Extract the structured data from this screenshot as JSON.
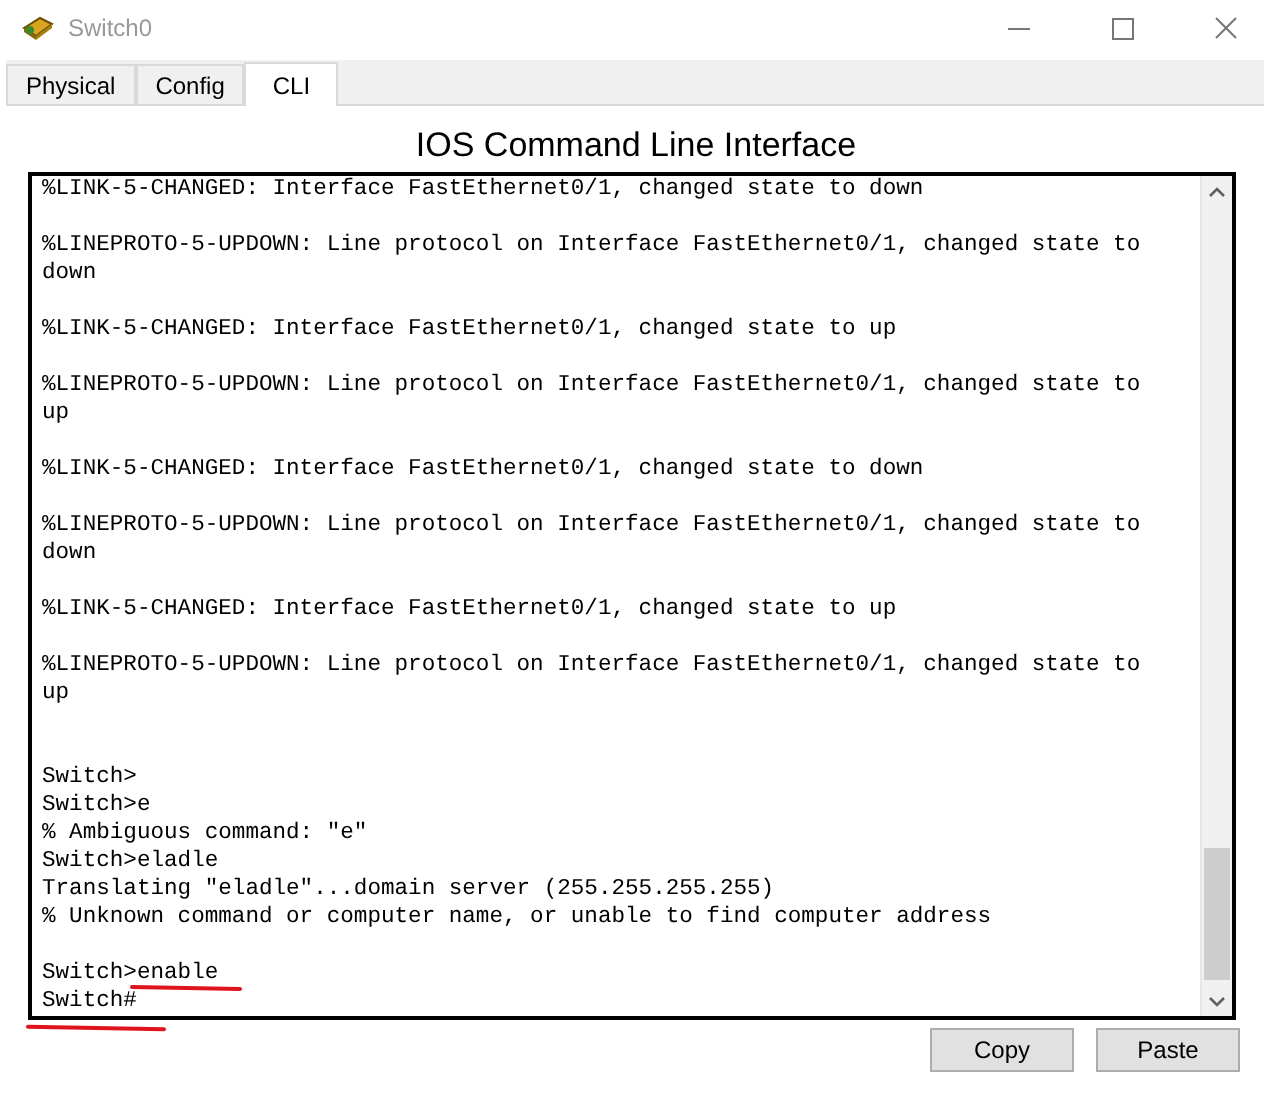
{
  "window": {
    "title": "Switch0"
  },
  "tabs": [
    {
      "label": "Physical",
      "selected": false
    },
    {
      "label": "Config",
      "selected": false
    },
    {
      "label": "CLI",
      "selected": true
    }
  ],
  "heading": "IOS Command Line Interface",
  "terminal": {
    "lines": [
      {
        "kind": "text",
        "text": "%LINK-5-CHANGED: Interface FastEthernet0/1, changed state to down"
      },
      {
        "kind": "blank"
      },
      {
        "kind": "text",
        "text": "%LINEPROTO-5-UPDOWN: Line protocol on Interface FastEthernet0/1, changed state to"
      },
      {
        "kind": "text",
        "text": "down"
      },
      {
        "kind": "blank"
      },
      {
        "kind": "text",
        "text": "%LINK-5-CHANGED: Interface FastEthernet0/1, changed state to up"
      },
      {
        "kind": "blank"
      },
      {
        "kind": "text",
        "text": "%LINEPROTO-5-UPDOWN: Line protocol on Interface FastEthernet0/1, changed state to"
      },
      {
        "kind": "text",
        "text": "up"
      },
      {
        "kind": "blank"
      },
      {
        "kind": "text",
        "text": "%LINK-5-CHANGED: Interface FastEthernet0/1, changed state to down"
      },
      {
        "kind": "blank"
      },
      {
        "kind": "text",
        "text": "%LINEPROTO-5-UPDOWN: Line protocol on Interface FastEthernet0/1, changed state to"
      },
      {
        "kind": "text",
        "text": "down"
      },
      {
        "kind": "blank"
      },
      {
        "kind": "text",
        "text": "%LINK-5-CHANGED: Interface FastEthernet0/1, changed state to up"
      },
      {
        "kind": "blank"
      },
      {
        "kind": "text",
        "text": "%LINEPROTO-5-UPDOWN: Line protocol on Interface FastEthernet0/1, changed state to"
      },
      {
        "kind": "text",
        "text": "up"
      },
      {
        "kind": "blank"
      },
      {
        "kind": "blank"
      },
      {
        "kind": "text",
        "text": "Switch>"
      },
      {
        "kind": "text",
        "text": "Switch>e"
      },
      {
        "kind": "text",
        "text": "% Ambiguous command: \"e\""
      },
      {
        "kind": "text",
        "text": "Switch>eladle"
      },
      {
        "kind": "text",
        "text": "Translating \"eladle\"...domain server (255.255.255.255)"
      },
      {
        "kind": "text",
        "text": "% Unknown command or computer name, or unable to find computer address"
      },
      {
        "kind": "blank"
      },
      {
        "kind": "text",
        "text": "Switch>enable"
      },
      {
        "kind": "text",
        "text": "Switch#"
      }
    ]
  },
  "buttons": [
    "Copy",
    "Paste"
  ]
}
